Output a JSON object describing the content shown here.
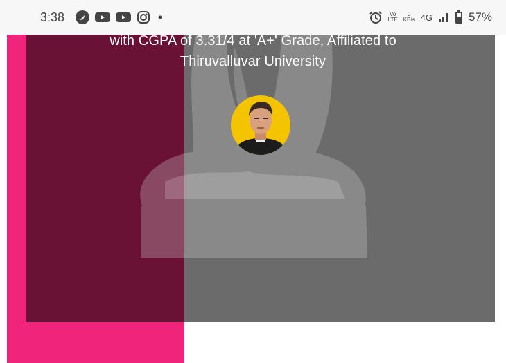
{
  "status_bar": {
    "time": "3:38",
    "network_label": "4G",
    "volte_label": "Vo\nLTE",
    "speed_value": "0",
    "speed_unit": "KB/s",
    "battery_percent": "57%",
    "left_icons": [
      "nav-icon",
      "youtube-icon",
      "youtube-icon",
      "instagram-icon",
      "dot-icon"
    ],
    "right_icons": [
      "alarm-icon",
      "signal-icon",
      "battery-icon"
    ]
  },
  "hero": {
    "line1": "with CGPA of 3.31/4 at 'A+' Grade, Affiliated to",
    "line2": "Thiruvalluvar University"
  },
  "colors": {
    "accent_pink": "#f0247a",
    "overlay_dark": "#6a1236",
    "overlay_grey": "#6b6b6b",
    "portrait_ring": "#f5c400"
  }
}
